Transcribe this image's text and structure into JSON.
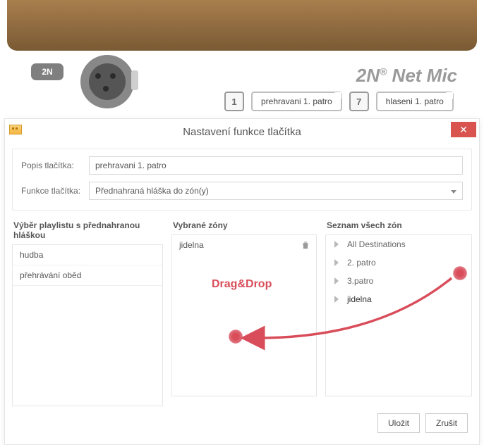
{
  "device": {
    "brand": "2N",
    "title_prefix": "2N",
    "title_suffix": " Net Mic",
    "buttons": [
      {
        "num": "1",
        "label": "prehravani 1. patro"
      },
      {
        "num": "7",
        "label": "hlaseni 1. patro"
      }
    ]
  },
  "modal": {
    "title": "Nastavení funkce tlačítka",
    "desc_label": "Popis tlačítka:",
    "desc_value": "prehravani 1. patro",
    "func_label": "Funkce tlačítka:",
    "func_value": "Přednahraná hláška do zón(y)",
    "col1_title": "Výběr playlistu s přednahranou hláškou",
    "col2_title": "Vybrané zóny",
    "col3_title": "Seznam všech zón",
    "playlists": [
      "hudba",
      "přehrávání oběd"
    ],
    "selected_zones": [
      "jidelna"
    ],
    "all_zones": [
      "All Destinations",
      "2. patro",
      "3.patro",
      "jidelna"
    ],
    "save_label": "Uložit",
    "cancel_label": "Zrušit"
  },
  "annotation": {
    "text": "Drag&Drop"
  }
}
